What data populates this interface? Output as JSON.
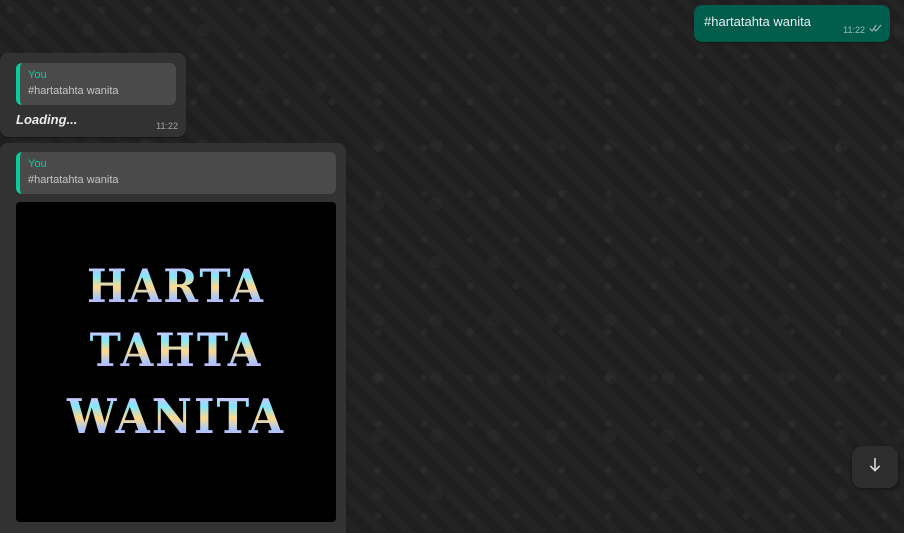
{
  "conversation": {
    "messages": [
      {
        "direction": "outgoing",
        "text": "#hartatahta wanita",
        "time": "11:22",
        "status_icon": "double-check-icon"
      },
      {
        "direction": "incoming",
        "quote": {
          "author": "You",
          "text": "#hartatahta wanita"
        },
        "text": "Loading...",
        "time": "11:22"
      },
      {
        "direction": "incoming",
        "quote": {
          "author": "You",
          "text": "#hartatahta wanita"
        },
        "image_text_lines": [
          "HARTA",
          "TAHTA",
          "WANITA"
        ]
      }
    ]
  },
  "controls": {
    "scroll_down_icon": "arrow-down-icon"
  },
  "colors": {
    "background": "#1f1f1f",
    "outgoing_bubble": "#005c4b",
    "incoming_bubble": "#323232",
    "quote_accent": "#06cf9c"
  }
}
